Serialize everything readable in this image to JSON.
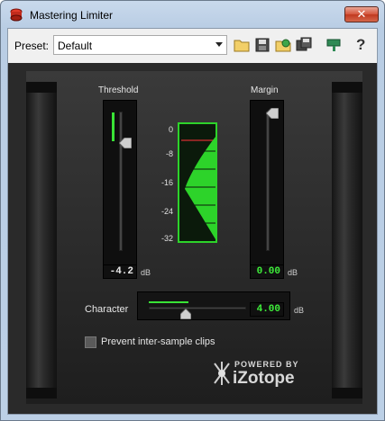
{
  "window": {
    "title": "Mastering Limiter",
    "close_label": "✕"
  },
  "toolbar": {
    "preset_label": "Preset:",
    "preset_value": "Default",
    "buttons": [
      "open-folder-icon",
      "save-icon",
      "load-preset-icon",
      "save-as-icon",
      "bypass-icon",
      "help-icon"
    ],
    "help_label": "?"
  },
  "limiter": {
    "threshold_label": "Threshold",
    "threshold_value": "-4.2",
    "threshold_level": 0.8,
    "margin_label": "Margin",
    "margin_value": "0.00",
    "margin_level": 0.97,
    "unit": "dB",
    "meter_scale": [
      "0",
      "-8",
      "-16",
      "-24",
      "-32"
    ],
    "character_label": "Character",
    "character_value": "4.00",
    "character_level": 0.45,
    "prevent_clips_label": "Prevent inter-sample clips",
    "prevent_clips_checked": false
  },
  "branding": {
    "powered_by": "POWERED BY",
    "brand_name": "iZotope"
  },
  "colors": {
    "meter_green": "#2dd32a",
    "readout_green": "#3ef03a",
    "panel_bg": "#2a2a2a"
  }
}
